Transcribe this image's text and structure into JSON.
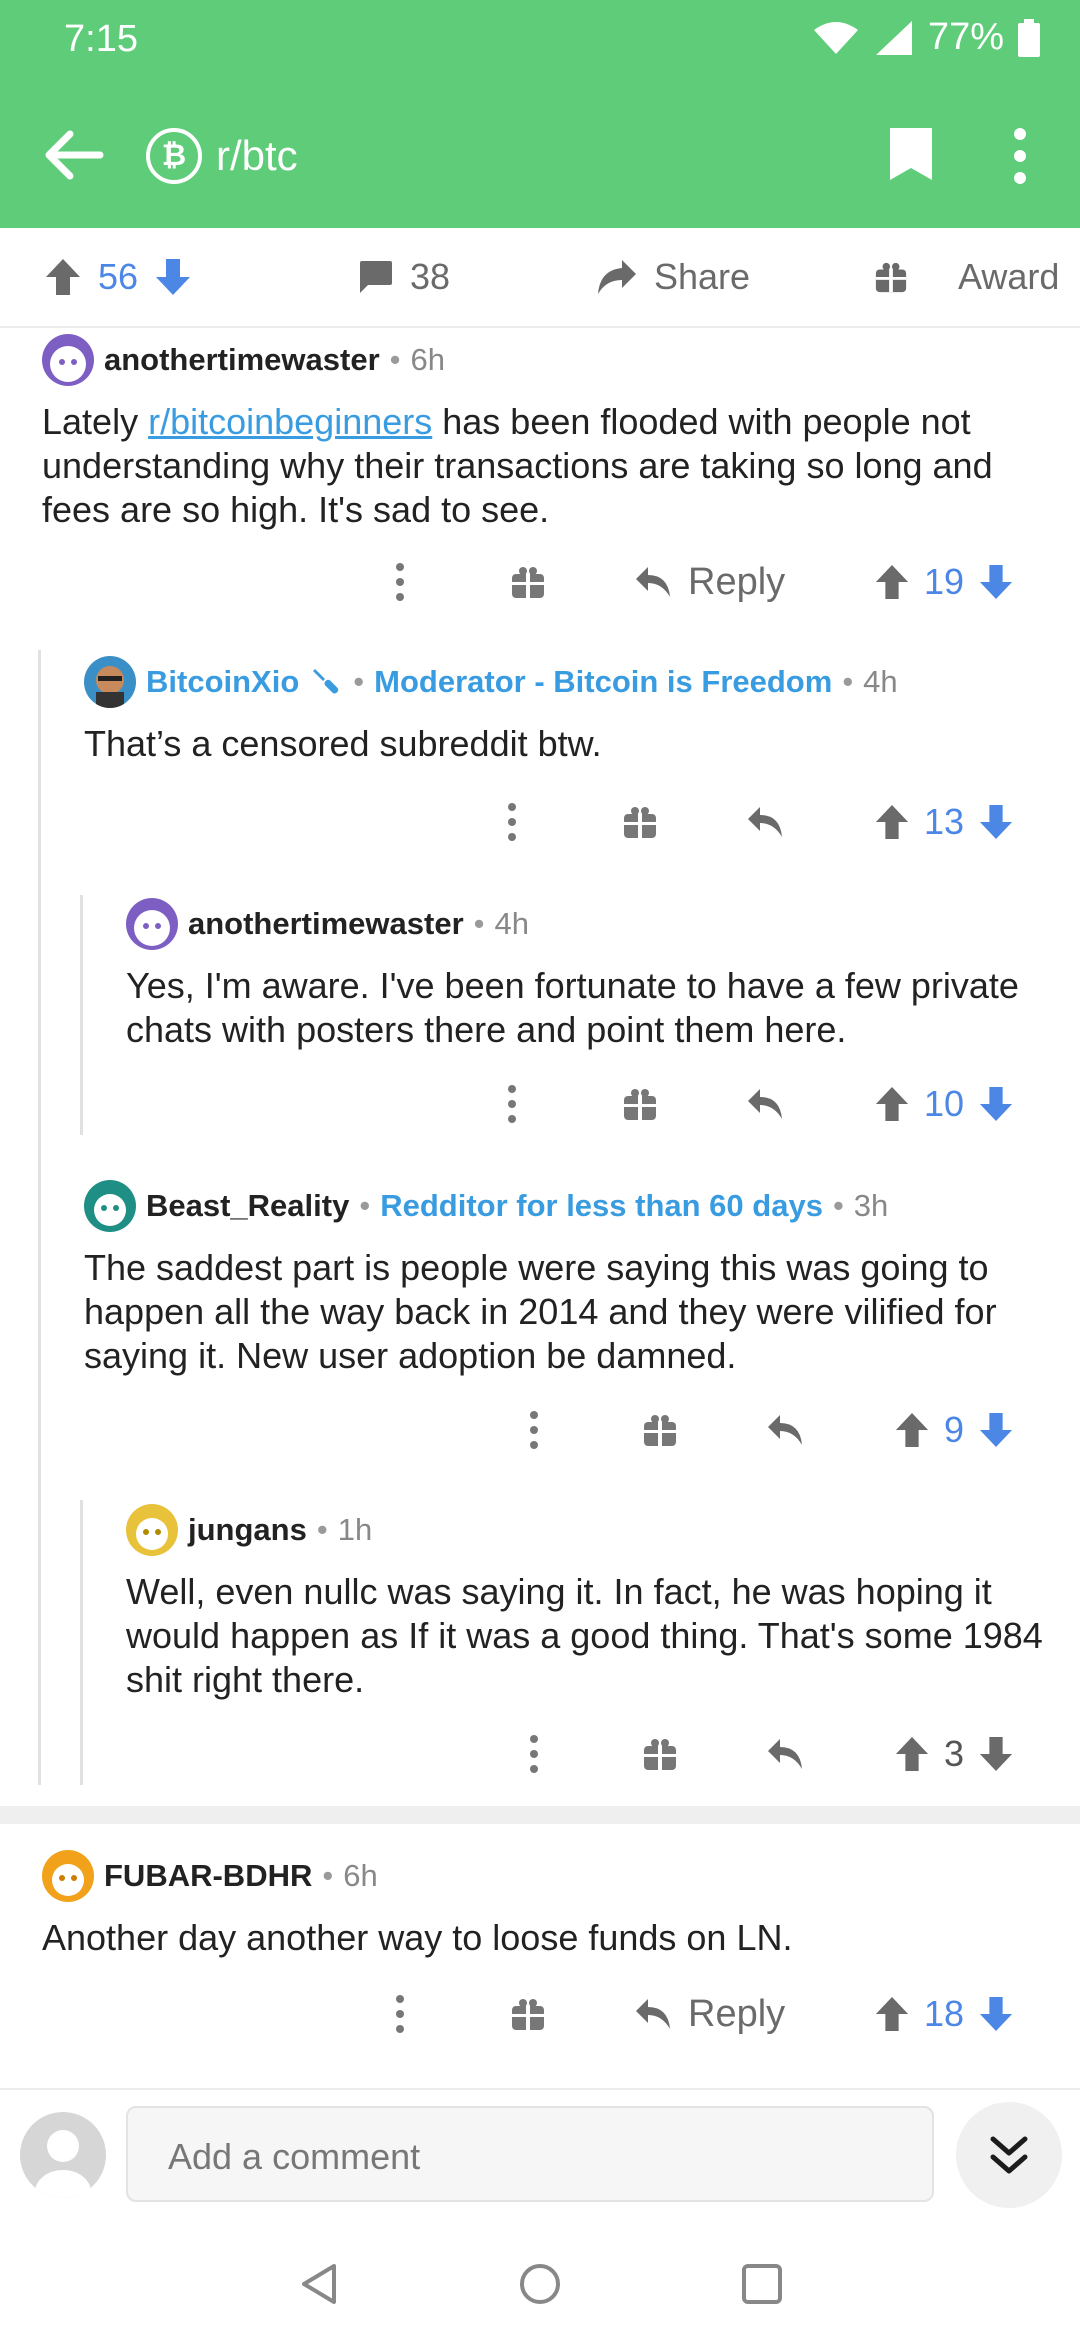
{
  "status": {
    "time": "7:15",
    "battery": "77%"
  },
  "header": {
    "subreddit": "r/btc",
    "subreddit_icon": "bitcoin-badge"
  },
  "post_actions": {
    "upvotes": "56",
    "comments": "38",
    "share": "Share",
    "award": "Award"
  },
  "comments": [
    {
      "user": "anothertimewaster",
      "time": "6h",
      "text_before": "Lately ",
      "link": "r/bitcoinbeginners",
      "text_after": " has been flooded with people not understanding why their transactions are taking so long and fees are so high. It's sad to see.",
      "reply_label": "Reply",
      "votes": "19"
    },
    {
      "user": "BitcoinXio",
      "flair": "Moderator - Bitcoin is Freedom",
      "time": "4h",
      "text": "That’s a censored subreddit btw.",
      "votes": "13"
    },
    {
      "user": "anothertimewaster",
      "time": "4h",
      "text": "Yes, I'm aware. I've been fortunate to have a few private chats with posters there and point them here.",
      "votes": "10"
    },
    {
      "user": "Beast_Reality",
      "flair": "Redditor for less than 60 days",
      "time": "3h",
      "text": "The saddest part is people were saying this was going to happen all the way back in 2014 and they were vilified for saying it. New user adoption be damned.",
      "votes": "9"
    },
    {
      "user": "jungans",
      "time": "1h",
      "text": "Well, even nullc was saying it. In fact, he was hoping it would happen as If it was a good thing. That's some 1984 shit right there.",
      "votes": "3"
    },
    {
      "user": "FUBAR-BDHR",
      "time": "6h",
      "text": "Another day another way to loose funds on LN.",
      "reply_label": "Reply",
      "votes": "18"
    }
  ],
  "composer": {
    "placeholder": "Add a comment"
  },
  "colors": {
    "header": "#5ecc78",
    "link": "#3a9ce0",
    "vote": "#4c87e5"
  }
}
